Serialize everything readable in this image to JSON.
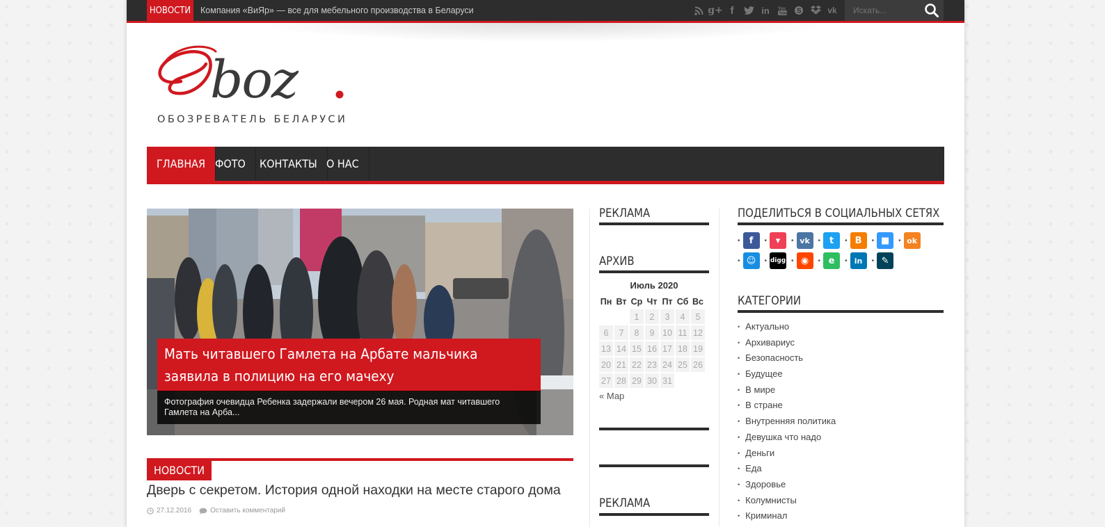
{
  "topbar": {
    "ticker_label": "НОВОСТИ",
    "ticker_text": "Компания «ВиЯр» — все для мебельного производства в Беларуси",
    "search_placeholder": "Искать...",
    "social_icons": [
      "rss-icon",
      "google-plus-icon",
      "facebook-icon",
      "twitter-icon",
      "linkedin-icon",
      "youtube-icon",
      "skype-icon",
      "dropbox-icon",
      "vk-icon"
    ]
  },
  "logo": {
    "name": "Oboz.",
    "tagline": "ОБОЗРЕВАТЕЛЬ БЕЛАРУСИ"
  },
  "nav": {
    "items": [
      {
        "label": "ГЛАВНАЯ",
        "active": true
      },
      {
        "label": "ФОТО",
        "active": false
      },
      {
        "label": "КОНТАКТЫ",
        "active": false
      },
      {
        "label": "О НАС",
        "active": false
      }
    ]
  },
  "slider": {
    "title": "Мать читавшего Гамлета на Арбате мальчика заявила в полицию на его мачеху",
    "excerpt": "Фотография очевидца Ребенка задержали вечером 26 мая. Родная мат читавшего Гамлета на Арба..."
  },
  "news": {
    "section_label": "НОВОСТИ",
    "title": "Дверь с секретом. История одной находки на месте старого дома",
    "date": "27.12.2016",
    "comments": "Оставить комментарий"
  },
  "sidebar_middle": {
    "ad_title": "РЕКЛАМА",
    "archive_title": "АРХИВ",
    "ad_title_2": "РЕКЛАМА",
    "calendar": {
      "caption": "Июль 2020",
      "weekdays": [
        "Пн",
        "Вт",
        "Ср",
        "Чт",
        "Пт",
        "Сб",
        "Вс"
      ],
      "weeks": [
        [
          "",
          "",
          "1",
          "2",
          "3",
          "4",
          "5"
        ],
        [
          "6",
          "7",
          "8",
          "9",
          "10",
          "11",
          "12"
        ],
        [
          "13",
          "14",
          "15",
          "16",
          "17",
          "18",
          "19"
        ],
        [
          "20",
          "21",
          "22",
          "23",
          "24",
          "25",
          "26"
        ],
        [
          "27",
          "28",
          "29",
          "30",
          "31",
          "",
          ""
        ]
      ],
      "prev_link": "« Мар"
    }
  },
  "sidebar_right": {
    "share_title": "ПОДЕЛИТЬСЯ В СОЦИАЛЬНЫХ СЕТЯХ",
    "share_icons": [
      {
        "name": "facebook-share-icon",
        "glyph": "f",
        "color": "#3b5998"
      },
      {
        "name": "pocket-share-icon",
        "glyph": "▾",
        "color": "#ef4056"
      },
      {
        "name": "vk-share-icon",
        "glyph": "vk",
        "color": "#4c75a3"
      },
      {
        "name": "twitter-share-icon",
        "glyph": "t",
        "color": "#1da1f2"
      },
      {
        "name": "blogger-share-icon",
        "glyph": "B",
        "color": "#f57d00"
      },
      {
        "name": "delicious-share-icon",
        "glyph": "■",
        "color": "#3399ff"
      },
      {
        "name": "odnoklassniki-share-icon",
        "glyph": "ok",
        "color": "#f58220"
      },
      {
        "name": "myworld-share-icon",
        "glyph": "☺",
        "color": "#168de2"
      },
      {
        "name": "digg-share-icon",
        "glyph": "digg",
        "color": "#000000"
      },
      {
        "name": "reddit-share-icon",
        "glyph": "◉",
        "color": "#ff4500"
      },
      {
        "name": "evernote-share-icon",
        "glyph": "e",
        "color": "#2dbe60"
      },
      {
        "name": "linkedin-share-icon",
        "glyph": "in",
        "color": "#0077b5"
      },
      {
        "name": "livejournal-share-icon",
        "glyph": "✎",
        "color": "#004359"
      }
    ],
    "categories_title": "КАТЕГОРИИ",
    "categories": [
      "Актуально",
      "Архивариус",
      "Безопасность",
      "Будущее",
      "В мире",
      "В стране",
      "Внутренняя политика",
      "Девушка что надо",
      "Деньги",
      "Еда",
      "Здоровье",
      "Колумнисты",
      "Криминал"
    ]
  },
  "colors": {
    "accent": "#d0181f",
    "dark": "#2d2d2d"
  }
}
